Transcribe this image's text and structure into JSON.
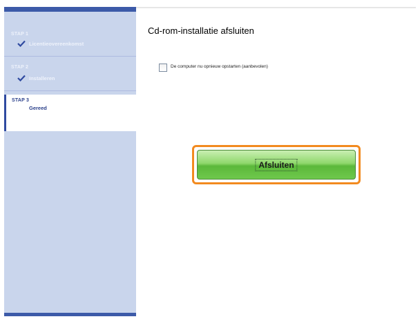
{
  "sidebar": {
    "steps": [
      {
        "num": "STAP 1",
        "label": "Licentieovereenkomst",
        "state": "done"
      },
      {
        "num": "STAP 2",
        "label": "Installeren",
        "state": "done"
      },
      {
        "num": "STAP 3",
        "label": "Gereed",
        "state": "active"
      }
    ]
  },
  "main": {
    "title": "Cd-rom-installatie afsluiten",
    "restart_checkbox": {
      "label": "De computer nu opnieuw opstarten (aanbevolen)",
      "checked": false
    },
    "finish_button": "Afsluiten"
  },
  "colors": {
    "sidebar_bg": "#c9d5ec",
    "accent": "#3c5aa8",
    "highlight": "#f28a1f",
    "button_green": "#6fc84c"
  }
}
